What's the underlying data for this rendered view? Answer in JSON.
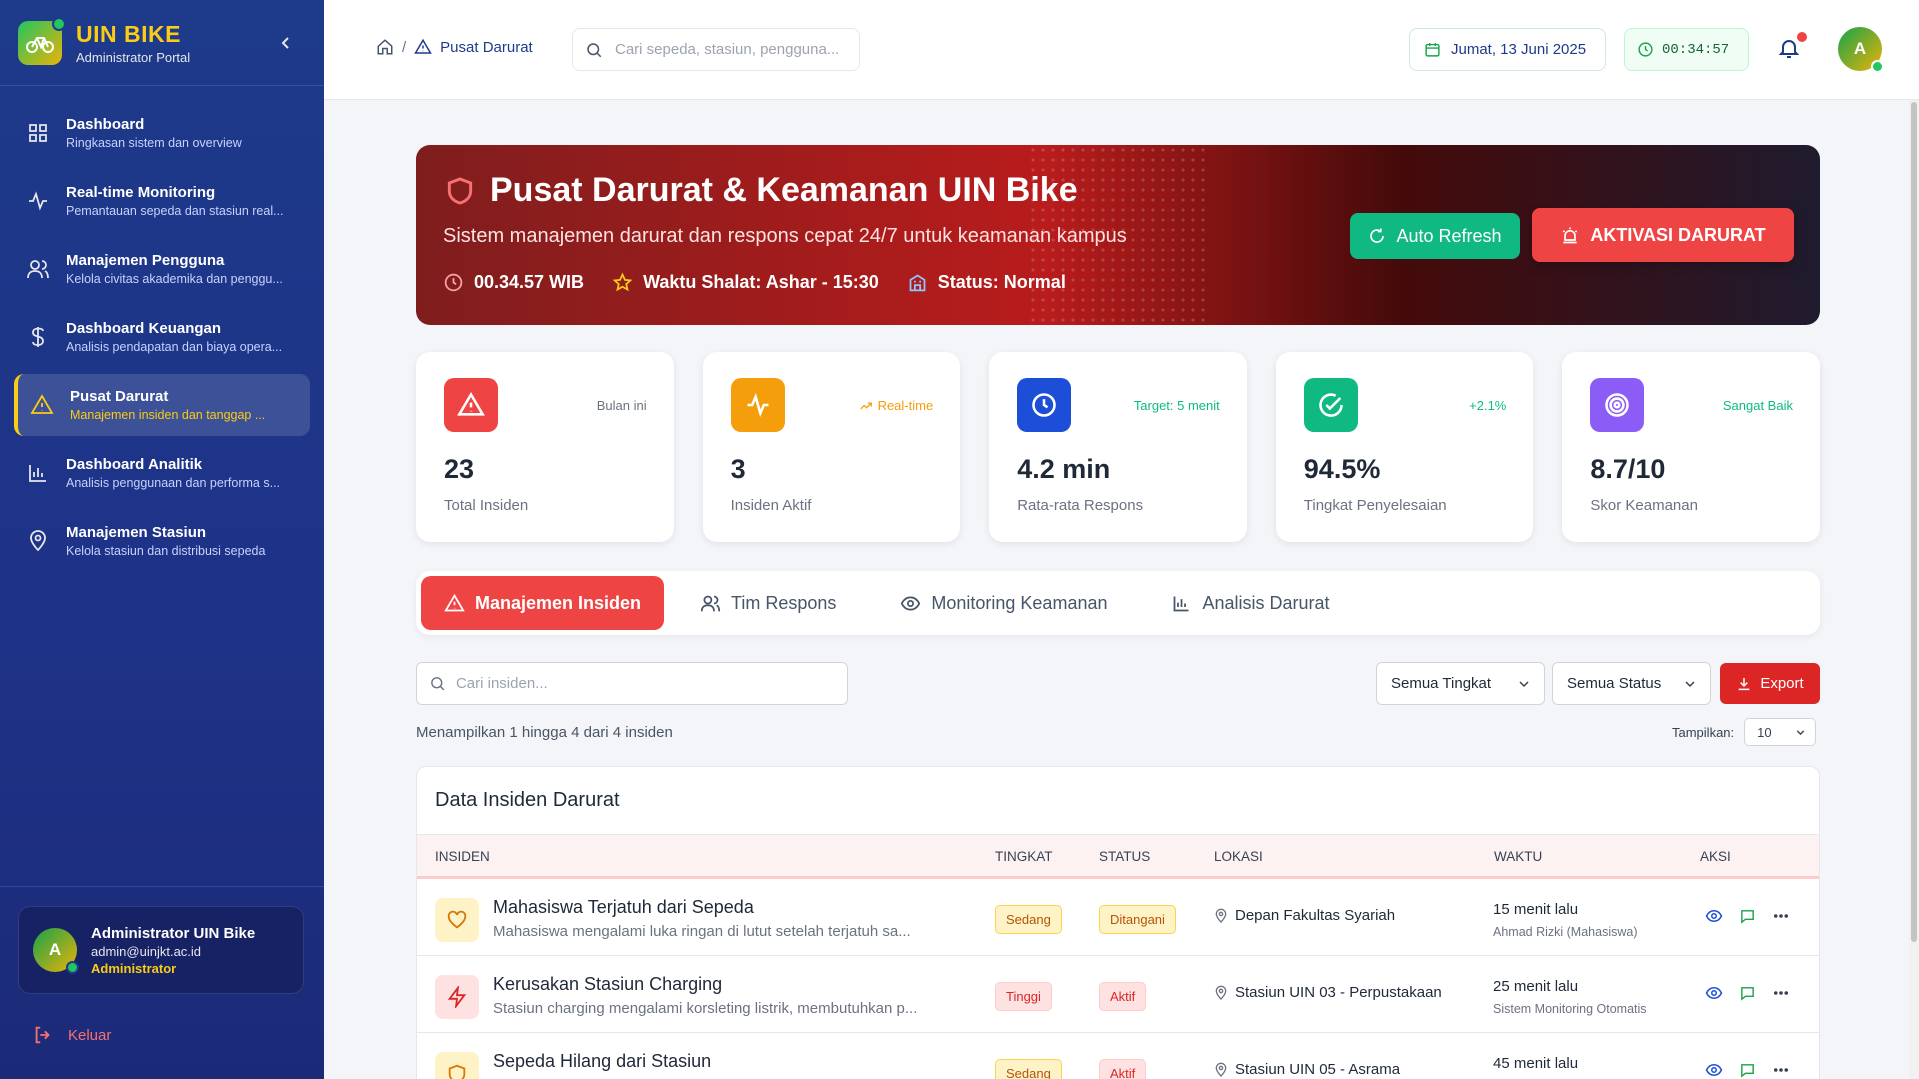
{
  "brand": {
    "title": "UIN BIKE",
    "subtitle": "Administrator Portal"
  },
  "sidebar": {
    "items": [
      {
        "title": "Dashboard",
        "desc": "Ringkasan sistem dan overview",
        "icon": "grid-icon"
      },
      {
        "title": "Real-time Monitoring",
        "desc": "Pemantauan sepeda dan stasiun real...",
        "icon": "activity-icon"
      },
      {
        "title": "Manajemen Pengguna",
        "desc": "Kelola civitas akademika dan penggu...",
        "icon": "users-icon"
      },
      {
        "title": "Dashboard Keuangan",
        "desc": "Analisis pendapatan dan biaya opera...",
        "icon": "dollar-icon"
      },
      {
        "title": "Pusat Darurat",
        "desc": "Manajemen insiden dan tanggap ...",
        "icon": "warning-icon",
        "active": true
      },
      {
        "title": "Dashboard Analitik",
        "desc": "Analisis penggunaan dan performa s...",
        "icon": "bar-chart-icon"
      },
      {
        "title": "Manajemen Stasiun",
        "desc": "Kelola stasiun dan distribusi sepeda",
        "icon": "map-pin-icon"
      }
    ],
    "user": {
      "initial": "A",
      "name": "Administrator UIN Bike",
      "email": "admin@uinjkt.ac.id",
      "role": "Administrator"
    },
    "logout": "Keluar"
  },
  "topbar": {
    "breadcrumb_sep": "/",
    "breadcrumb_current": "Pusat Darurat",
    "search_placeholder": "Cari sepeda, stasiun, pengguna...",
    "date": "Jumat, 13 Juni 2025",
    "clock": "00:34:57",
    "avatar_initial": "A"
  },
  "hero": {
    "title": "Pusat Darurat & Keamanan UIN Bike",
    "subtitle": "Sistem manajemen darurat dan respons cepat 24/7 untuk keamanan kampus",
    "time": "00.34.57 WIB",
    "prayer": "Waktu Shalat: Ashar - 15:30",
    "status": "Status: Normal",
    "refresh_label": "Auto Refresh",
    "alarm_label": "AKTIVASI DARURAT"
  },
  "stats": [
    {
      "value": "23",
      "label": "Total Insiden",
      "tag": "Bulan ini",
      "color": "#ef4444",
      "tag_color": "#6b7280",
      "icon": "alert-triangle-icon"
    },
    {
      "value": "3",
      "label": "Insiden Aktif",
      "tag": "Real-time",
      "color": "#f59e0b",
      "tag_color": "#f59e0b",
      "icon": "pulse-icon"
    },
    {
      "value": "4.2 min",
      "label": "Rata-rata Respons",
      "tag": "Target: 5 menit",
      "color": "#1d4ed8",
      "tag_color": "#10b981",
      "icon": "clock-icon"
    },
    {
      "value": "94.5%",
      "label": "Tingkat Penyelesaian",
      "tag": "+2.1%",
      "color": "#10b981",
      "tag_color": "#10b981",
      "icon": "check-circle-icon"
    },
    {
      "value": "8.7/10",
      "label": "Skor Keamanan",
      "tag": "Sangat Baik",
      "color": "#8b5cf6",
      "tag_color": "#10b981",
      "icon": "target-icon"
    }
  ],
  "tabs": [
    {
      "label": "Manajemen Insiden",
      "active": true
    },
    {
      "label": "Tim Respons"
    },
    {
      "label": "Monitoring Keamanan"
    },
    {
      "label": "Analisis Darurat"
    }
  ],
  "filters": {
    "search_placeholder": "Cari insiden...",
    "level": "Semua Tingkat",
    "status": "Semua Status",
    "export": "Export",
    "showing": "Menampilkan 1 hingga 4 dari 4 insiden",
    "per_page_label": "Tampilkan:",
    "per_page": "10"
  },
  "table": {
    "title": "Data Insiden Darurat",
    "headers": [
      "INSIDEN",
      "TINGKAT",
      "STATUS",
      "LOKASI",
      "WAKTU",
      "AKSI"
    ],
    "rows": [
      {
        "title": "Mahasiswa Terjatuh dari Sepeda",
        "desc": "Mahasiswa mengalami luka ringan di lutut setelah terjatuh sa...",
        "level": "Sedang",
        "status": "Ditangani",
        "location": "Depan Fakultas Syariah",
        "time": "15 menit lalu",
        "by": "Ahmad Rizki (Mahasiswa)",
        "icon": "heart-icon",
        "icon_color": "#d97706",
        "icon_bg": "#fef3c7"
      },
      {
        "title": "Kerusakan Stasiun Charging",
        "desc": "Stasiun charging mengalami korsleting listrik, membutuhkan p...",
        "level": "Tinggi",
        "status": "Aktif",
        "location": "Stasiun UIN 03 - Perpustakaan",
        "time": "25 menit lalu",
        "by": "Sistem Monitoring Otomatis",
        "icon": "bolt-icon",
        "icon_color": "#dc2626",
        "icon_bg": "#fee2e2"
      },
      {
        "title": "Sepeda Hilang dari Stasiun",
        "desc": "",
        "level": "Sedang",
        "status": "Aktif",
        "location": "Stasiun UIN 05 - Asrama",
        "time": "45 menit lalu",
        "by": "",
        "icon": "shield-icon",
        "icon_color": "#d97706",
        "icon_bg": "#fef3c7"
      }
    ]
  }
}
